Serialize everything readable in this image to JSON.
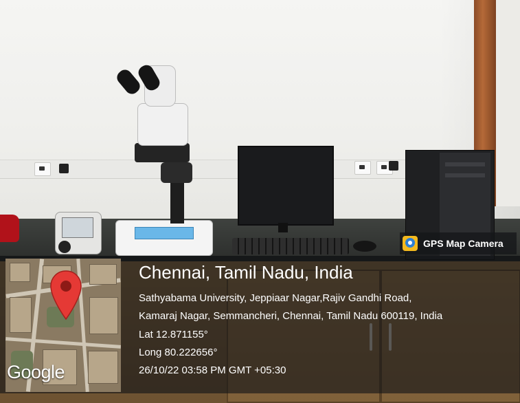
{
  "watermark": {
    "badge_label": "GPS Map Camera",
    "icon": "gps-map-camera-icon",
    "brand_color": "#f3b91e"
  },
  "location": {
    "title": "Chennai, Tamil Nadu, India",
    "address_line_1": "Sathyabama University, Jeppiaar Nagar,Rajiv Gandhi Road,",
    "address_line_2": "Kamaraj Nagar, Semmancheri, Chennai, Tamil Nadu 600119, India",
    "latitude": "Lat 12.871155°",
    "longitude": "Long 80.222656°",
    "timestamp": "26/10/22 03:58 PM GMT +05:30"
  },
  "map": {
    "attribution": "Google",
    "marker_icon": "map-pin-icon",
    "marker_color": "#e53935"
  }
}
